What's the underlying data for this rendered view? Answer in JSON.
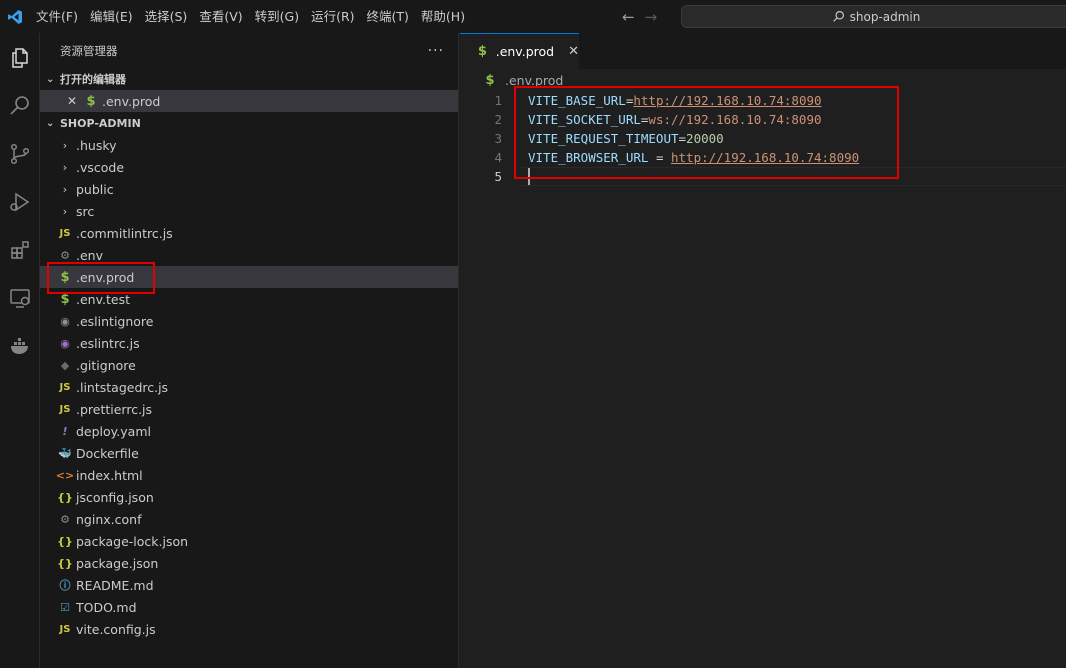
{
  "titlebar": {
    "menu": [
      "文件(F)",
      "编辑(E)",
      "选择(S)",
      "查看(V)",
      "转到(G)",
      "运行(R)",
      "终端(T)",
      "帮助(H)"
    ],
    "search_text": "shop-admin"
  },
  "sidebar": {
    "title": "资源管理器",
    "more": "···",
    "open_editors_label": "打开的编辑器",
    "open_editor_file": ".env.prod",
    "project_label": "SHOP-ADMIN",
    "folders": [
      ".husky",
      ".vscode",
      "public",
      "src"
    ],
    "files": [
      {
        "name": ".commitlintrc.js",
        "icon": "js-icon"
      },
      {
        "name": ".env",
        "icon": "gear-icon"
      },
      {
        "name": ".env.prod",
        "icon": "dollar-icon"
      },
      {
        "name": ".env.test",
        "icon": "dollar-icon"
      },
      {
        "name": ".eslintignore",
        "icon": "eslint-icon"
      },
      {
        "name": ".eslintrc.js",
        "icon": "eslint-icon"
      },
      {
        "name": ".gitignore",
        "icon": "git-icon"
      },
      {
        "name": ".lintstagedrc.js",
        "icon": "js-icon"
      },
      {
        "name": ".prettierrc.js",
        "icon": "js-icon"
      },
      {
        "name": "deploy.yaml",
        "icon": "yaml-icon"
      },
      {
        "name": "Dockerfile",
        "icon": "docker-icon"
      },
      {
        "name": "index.html",
        "icon": "html-icon"
      },
      {
        "name": "jsconfig.json",
        "icon": "json-icon"
      },
      {
        "name": "nginx.conf",
        "icon": "gear-icon"
      },
      {
        "name": "package-lock.json",
        "icon": "json-icon"
      },
      {
        "name": "package.json",
        "icon": "json-icon"
      },
      {
        "name": "README.md",
        "icon": "info-icon"
      },
      {
        "name": "TODO.md",
        "icon": "todo-icon"
      },
      {
        "name": "vite.config.js",
        "icon": "js-icon"
      }
    ]
  },
  "editor": {
    "tab_label": ".env.prod",
    "breadcrumb": ".env.prod",
    "lines": [
      {
        "no": "1",
        "key": "VITE_BASE_URL",
        "op": "=",
        "value": "http://192.168.10.74:8090",
        "type": "url"
      },
      {
        "no": "2",
        "key": "VITE_SOCKET_URL",
        "op": "=",
        "value": "ws://192.168.10.74:8090",
        "type": "str"
      },
      {
        "no": "3",
        "key": "VITE_REQUEST_TIMEOUT",
        "op": "=",
        "value": "20000",
        "type": "num"
      },
      {
        "no": "4",
        "key": "VITE_BROWSER_URL",
        "op": " = ",
        "value": "http://192.168.10.74:8090",
        "type": "url"
      },
      {
        "no": "5",
        "key": "",
        "op": "",
        "value": "",
        "type": "empty"
      }
    ]
  },
  "colors": {
    "accent": "#0078d4",
    "annotation_red": "#e00000"
  }
}
